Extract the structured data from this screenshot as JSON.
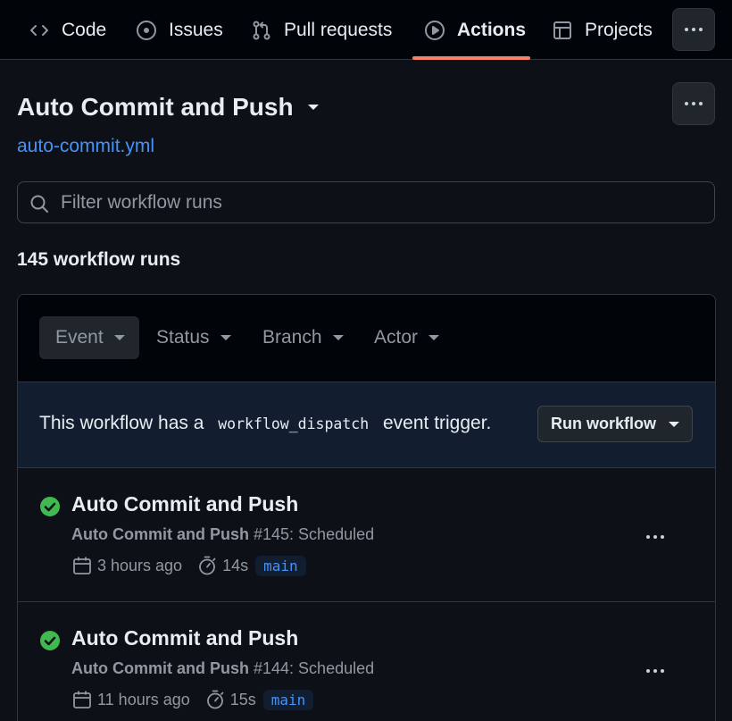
{
  "nav": {
    "tabs": [
      {
        "label": "Code",
        "icon": "code-icon"
      },
      {
        "label": "Issues",
        "icon": "issue-opened-icon"
      },
      {
        "label": "Pull requests",
        "icon": "git-pull-request-icon"
      },
      {
        "label": "Actions",
        "icon": "play-icon",
        "active": true
      },
      {
        "label": "Projects",
        "icon": "table-icon"
      }
    ],
    "more_icon": "kebab-horizontal-icon"
  },
  "workflow": {
    "title": "Auto Commit and Push",
    "file": "auto-commit.yml"
  },
  "search": {
    "placeholder": "Filter workflow runs"
  },
  "runs_count": "145 workflow runs",
  "filters": [
    "Event",
    "Status",
    "Branch",
    "Actor"
  ],
  "dispatch": {
    "text_before": "This workflow has a",
    "code": "workflow_dispatch",
    "text_after": "event trigger.",
    "button": "Run workflow"
  },
  "runs": [
    {
      "title": "Auto Commit and Push",
      "workflow_name": "Auto Commit and Push",
      "detail": " #145: Scheduled",
      "time": "3 hours ago",
      "duration": "14s",
      "branch": "main",
      "status": "success"
    },
    {
      "title": "Auto Commit and Push",
      "workflow_name": "Auto Commit and Push",
      "detail": " #144: Scheduled",
      "time": "11 hours ago",
      "duration": "15s",
      "branch": "main",
      "status": "success"
    }
  ],
  "colors": {
    "background": "#0d1117",
    "nav_background": "#010409",
    "accent_underline": "#f78166",
    "link": "#4493f8",
    "success": "#3fb950",
    "muted": "#9198a1"
  }
}
